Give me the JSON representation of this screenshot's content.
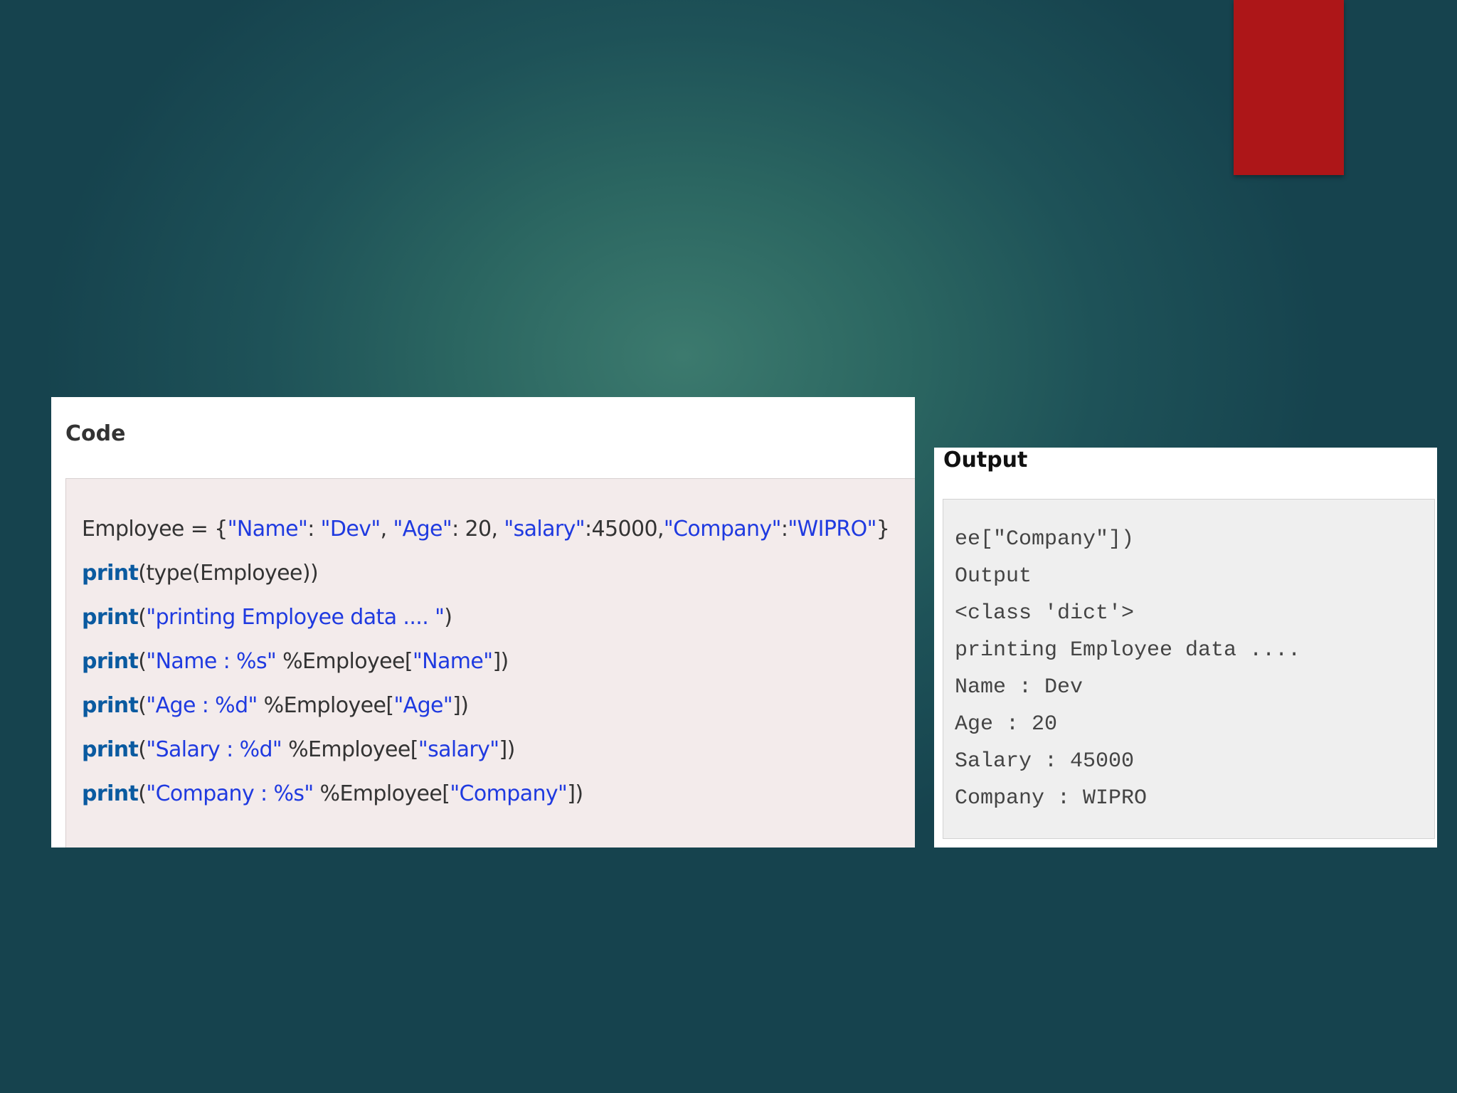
{
  "code_panel": {
    "title": "Code",
    "lines": [
      {
        "tokens": [
          {
            "text": "Employee = {",
            "kind": "plain"
          },
          {
            "text": "\"Name\"",
            "kind": "str"
          },
          {
            "text": ": ",
            "kind": "plain"
          },
          {
            "text": "\"Dev\"",
            "kind": "str"
          },
          {
            "text": ", ",
            "kind": "plain"
          },
          {
            "text": "\"Age\"",
            "kind": "str"
          },
          {
            "text": ": 20, ",
            "kind": "plain"
          },
          {
            "text": "\"salary\"",
            "kind": "str"
          },
          {
            "text": ":45000,",
            "kind": "plain"
          },
          {
            "text": "\"Company\"",
            "kind": "str"
          },
          {
            "text": ":",
            "kind": "plain"
          },
          {
            "text": "\"WIPRO\"",
            "kind": "str"
          },
          {
            "text": "}",
            "kind": "plain"
          }
        ]
      },
      {
        "tokens": [
          {
            "text": "print",
            "kind": "kw"
          },
          {
            "text": "(type(Employee))",
            "kind": "plain"
          }
        ]
      },
      {
        "tokens": [
          {
            "text": "print",
            "kind": "kw"
          },
          {
            "text": "(",
            "kind": "plain"
          },
          {
            "text": "\"printing Employee data .... \"",
            "kind": "str"
          },
          {
            "text": ")",
            "kind": "plain"
          }
        ]
      },
      {
        "tokens": [
          {
            "text": "print",
            "kind": "kw"
          },
          {
            "text": "(",
            "kind": "plain"
          },
          {
            "text": "\"Name : %s\"",
            "kind": "str"
          },
          {
            "text": " %Employee[",
            "kind": "plain"
          },
          {
            "text": "\"Name\"",
            "kind": "str"
          },
          {
            "text": "])",
            "kind": "plain"
          }
        ]
      },
      {
        "tokens": [
          {
            "text": "print",
            "kind": "kw"
          },
          {
            "text": "(",
            "kind": "plain"
          },
          {
            "text": "\"Age : %d\"",
            "kind": "str"
          },
          {
            "text": " %Employee[",
            "kind": "plain"
          },
          {
            "text": "\"Age\"",
            "kind": "str"
          },
          {
            "text": "])",
            "kind": "plain"
          }
        ]
      },
      {
        "tokens": [
          {
            "text": "print",
            "kind": "kw"
          },
          {
            "text": "(",
            "kind": "plain"
          },
          {
            "text": "\"Salary : %d\"",
            "kind": "str"
          },
          {
            "text": " %Employee[",
            "kind": "plain"
          },
          {
            "text": "\"salary\"",
            "kind": "str"
          },
          {
            "text": "])",
            "kind": "plain"
          }
        ]
      },
      {
        "tokens": [
          {
            "text": "print",
            "kind": "kw"
          },
          {
            "text": "(",
            "kind": "plain"
          },
          {
            "text": "\"Company : %s\"",
            "kind": "str"
          },
          {
            "text": " %Employee[",
            "kind": "plain"
          },
          {
            "text": "\"Company\"",
            "kind": "str"
          },
          {
            "text": "])",
            "kind": "plain"
          }
        ]
      }
    ]
  },
  "output_panel": {
    "title": "Output",
    "lines": [
      "ee[\"Company\"])",
      "Output",
      "<class 'dict'>",
      "printing Employee data ....",
      "Name : Dev",
      "Age : 20",
      "Salary : 45000",
      "Company : WIPRO"
    ]
  },
  "colors": {
    "background": "#2b6661",
    "accent_red": "#ad1618",
    "keyword": "#0a5aa0",
    "string": "#1f3ae0",
    "code_bg": "#f3ebeb",
    "output_bg": "#efefef"
  }
}
